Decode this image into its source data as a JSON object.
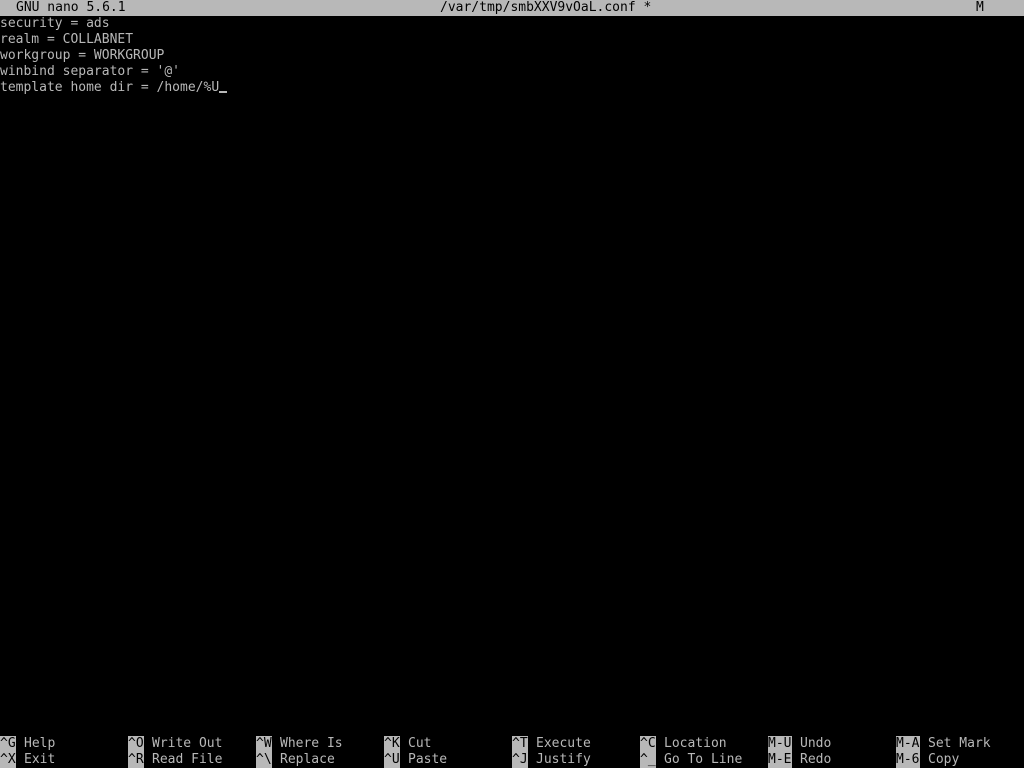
{
  "titlebar": {
    "app": "GNU nano 5.6.1",
    "file": "/var/tmp/smbXXV9vOaL.conf *",
    "modified_flag": "M"
  },
  "editor": {
    "lines": [
      "security = ads",
      "realm = COLLABNET",
      "workgroup = WORKGROUP",
      "winbind separator = '@'",
      "template home dir = /home/%U"
    ]
  },
  "shortcuts": [
    [
      {
        "key": "^G",
        "label": "Help"
      },
      {
        "key": "^X",
        "label": "Exit"
      }
    ],
    [
      {
        "key": "^O",
        "label": "Write Out"
      },
      {
        "key": "^R",
        "label": "Read File"
      }
    ],
    [
      {
        "key": "^W",
        "label": "Where Is"
      },
      {
        "key": "^\\",
        "label": "Replace"
      }
    ],
    [
      {
        "key": "^K",
        "label": "Cut"
      },
      {
        "key": "^U",
        "label": "Paste"
      }
    ],
    [
      {
        "key": "^T",
        "label": "Execute"
      },
      {
        "key": "^J",
        "label": "Justify"
      }
    ],
    [
      {
        "key": "^C",
        "label": "Location"
      },
      {
        "key": "^_",
        "label": "Go To Line"
      }
    ],
    [
      {
        "key": "M-U",
        "label": "Undo"
      },
      {
        "key": "M-E",
        "label": "Redo"
      }
    ],
    [
      {
        "key": "M-A",
        "label": "Set Mark"
      },
      {
        "key": "M-6",
        "label": "Copy"
      }
    ]
  ]
}
